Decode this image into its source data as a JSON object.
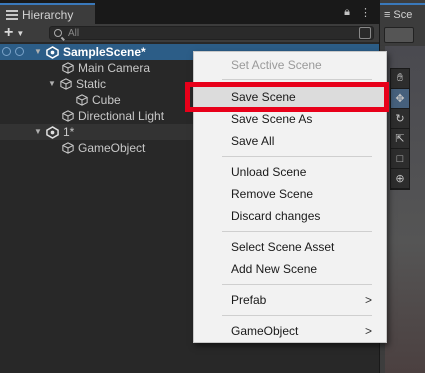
{
  "hierarchy": {
    "tab_title": "Hierarchy",
    "search_placeholder": "All",
    "add_label": "+",
    "items": [
      {
        "label": "SampleScene*"
      },
      {
        "label": "Main Camera"
      },
      {
        "label": "Static"
      },
      {
        "label": "Cube"
      },
      {
        "label": "Directional Light"
      },
      {
        "label": "1*"
      },
      {
        "label": "GameObject"
      }
    ]
  },
  "scene": {
    "tab_title": "Sce",
    "tools": [
      "hand-tool-icon",
      "move-tool-icon",
      "rotate-tool-icon",
      "scale-tool-icon",
      "rect-tool-icon",
      "transform-tool-icon"
    ]
  },
  "context_menu": {
    "items": [
      {
        "label": "Set Active Scene",
        "disabled": true
      },
      {
        "label": "Save Scene",
        "highlighted": true
      },
      {
        "label": "Save Scene As"
      },
      {
        "label": "Save All"
      },
      {
        "label": "Unload Scene"
      },
      {
        "label": "Remove Scene"
      },
      {
        "label": "Discard changes"
      },
      {
        "label": "Select Scene Asset"
      },
      {
        "label": "Add New Scene"
      },
      {
        "label": "Prefab",
        "submenu": true
      },
      {
        "label": "GameObject",
        "submenu": true
      }
    ],
    "submenu_arrow": ">"
  },
  "colors": {
    "selection": "#2c5d87",
    "highlight_box": "#e8001a",
    "menu_bg": "#f2f2f2"
  }
}
